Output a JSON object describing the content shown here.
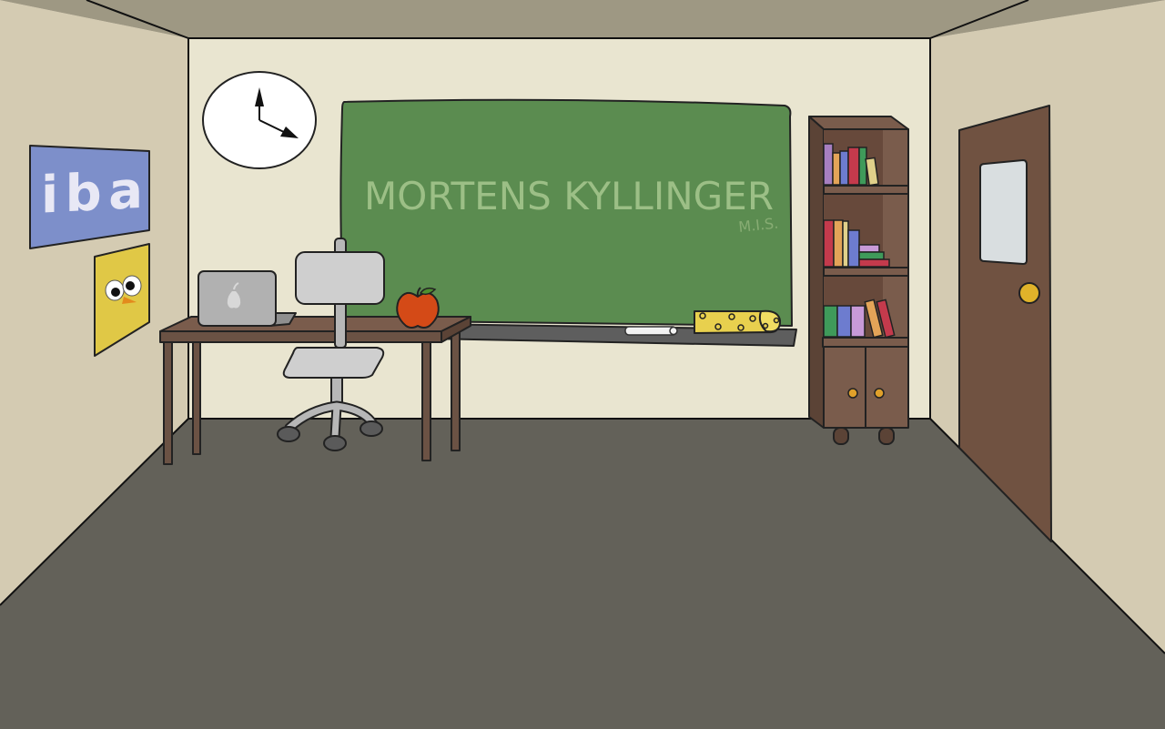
{
  "scene": {
    "room": "classroom",
    "blackboard": {
      "title": "MORTENS KYLLINGER",
      "signature": "M.I.S."
    },
    "poster_logo_text": "iba"
  },
  "colors": {
    "ceiling": "#9e9883",
    "side_walls": "#d4cbb2",
    "back_wall": "#e9e5d0",
    "floor": "#636159",
    "board": "#5b8c50",
    "wood_dark": "#6b5244",
    "door": "#705241",
    "poster_blue": "#7d8fca",
    "poster_yellow": "#e0c846",
    "apple": "#d44a17",
    "cheese": "#e8d04e",
    "chair_grey": "#cfcfcf"
  },
  "icons": [
    "clock-icon",
    "apple-icon",
    "laptop-icon",
    "cheese-icon",
    "chalk-icon",
    "door-knob-icon"
  ]
}
